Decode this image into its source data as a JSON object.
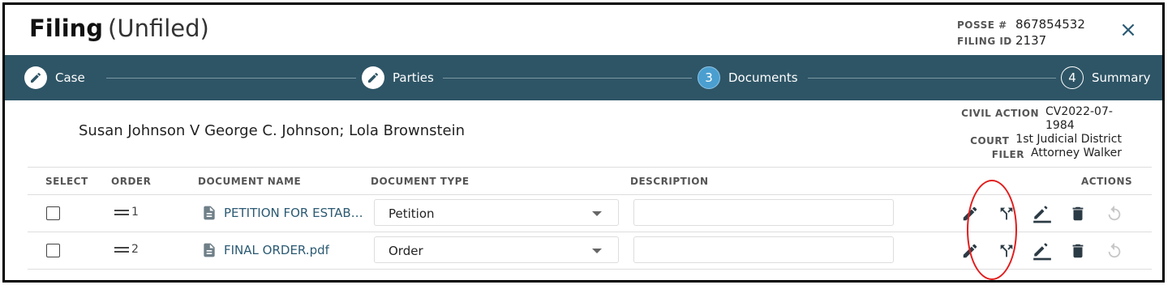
{
  "header": {
    "title": "Filing",
    "subtitle": "(Unfiled)",
    "posse_label": "POSSE #",
    "posse_value": "867854532",
    "filing_id_label": "FILING ID",
    "filing_id_value": "2137",
    "close_icon": "×"
  },
  "stepper": {
    "steps": [
      {
        "label": "Case",
        "state": "done",
        "marker": "pencil-icon"
      },
      {
        "label": "Parties",
        "state": "done",
        "marker": "pencil-icon"
      },
      {
        "label": "Documents",
        "state": "active",
        "marker": "3"
      },
      {
        "label": "Summary",
        "state": "todo",
        "marker": "4"
      }
    ]
  },
  "case": {
    "title": "Susan Johnson V George C. Johnson; Lola Brownstein",
    "civil_action_label": "CIVIL ACTION",
    "civil_action_value": "CV2022-07-1984",
    "court_label": "COURT",
    "court_value": "1st Judicial District",
    "filer_label": "FILER",
    "filer_value": "Attorney Walker"
  },
  "table": {
    "columns": {
      "select": "SELECT",
      "order": "ORDER",
      "name": "DOCUMENT NAME",
      "type": "DOCUMENT TYPE",
      "description": "DESCRIPTION",
      "actions": "ACTIONS"
    },
    "rows": [
      {
        "order": "1",
        "name": "PETITION FOR ESTABLISHMENT.pdf",
        "type": "Petition",
        "description": "",
        "checked": false
      },
      {
        "order": "2",
        "name": "FINAL ORDER.pdf",
        "type": "Order",
        "description": "",
        "checked": false
      }
    ],
    "action_icons": [
      "edit-icon",
      "split-icon",
      "sign-icon",
      "delete-icon",
      "undo-icon"
    ]
  },
  "colors": {
    "stepper_bg": "#2e5566",
    "active_step": "#4a9fd0",
    "link": "#2b5a73",
    "icon": "#2b3b45",
    "highlight": "#e21c1c"
  }
}
